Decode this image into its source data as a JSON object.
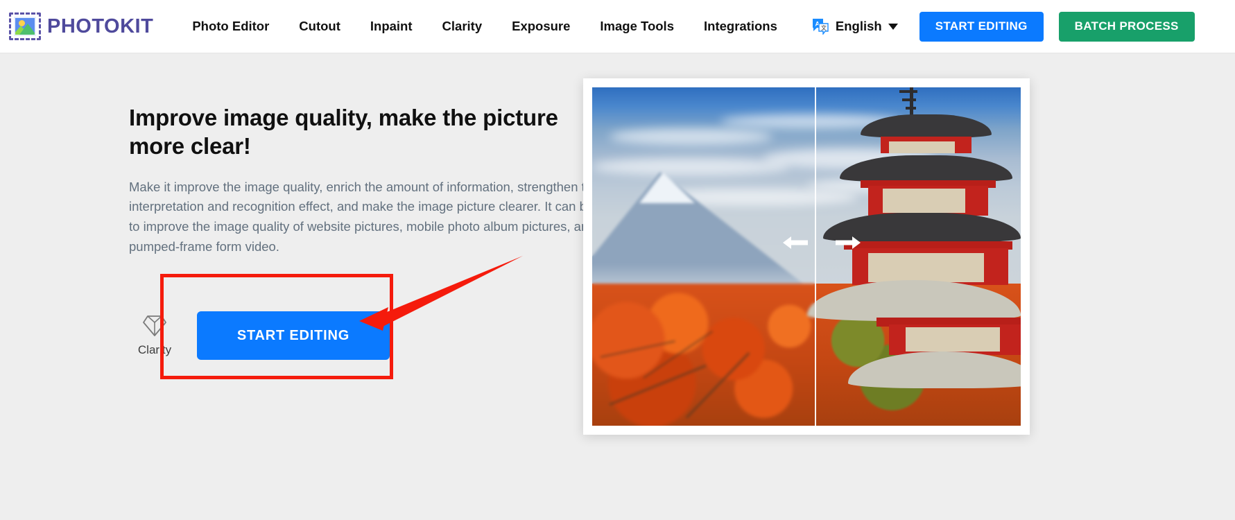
{
  "header": {
    "logo": {
      "icon": "photo-selection-icon",
      "text": "PHOTOKIT"
    },
    "nav_items": [
      {
        "label": "Photo Editor"
      },
      {
        "label": "Cutout"
      },
      {
        "label": "Inpaint"
      },
      {
        "label": "Clarity"
      },
      {
        "label": "Exposure"
      },
      {
        "label": "Image Tools"
      },
      {
        "label": "Integrations"
      }
    ],
    "language": {
      "icon": "translate-icon",
      "label": "English",
      "caret": "chevron-down-icon"
    },
    "start_editing_label": "START EDITING",
    "batch_process_label": "BATCH PROCESS",
    "start_editing_color": "#0b7aff",
    "batch_process_color": "#18a06a"
  },
  "hero": {
    "headline": "Improve image quality, make the picture more clear!",
    "paragraph": "Make it improve the image quality, enrich the amount of information, strengthen the image interpretation and recognition effect, and make the image picture clearer. It can be used to improve the image quality of website pictures, mobile photo album pictures, and pumped-frame form video.",
    "tool": {
      "icon": "diamond-icon",
      "label": "Clarity"
    },
    "cta_label": "START EDITING",
    "cta_color": "#0b7aff"
  },
  "preview": {
    "alt": "before-after comparison of Mount Fuji and Chureito Pagoda",
    "divider_position_percent": 52,
    "arrow_left_icon": "arrow-left-icon",
    "arrow_right_icon": "arrow-right-icon"
  },
  "annotation": {
    "highlight_color": "#f51b0c",
    "box_target": "start-editing-cta",
    "arrow": "pointer-arrow"
  }
}
